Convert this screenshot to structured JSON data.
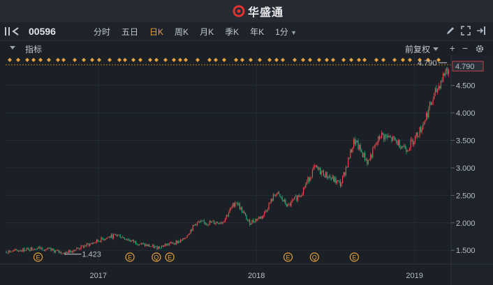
{
  "app": {
    "brand_name": "华盛通"
  },
  "toolbar": {
    "ticker": "00596",
    "tabs": [
      {
        "label": "分时",
        "active": false
      },
      {
        "label": "五日",
        "active": false
      },
      {
        "label": "日K",
        "active": true
      },
      {
        "label": "周K",
        "active": false
      },
      {
        "label": "月K",
        "active": false
      },
      {
        "label": "季K",
        "active": false
      },
      {
        "label": "年K",
        "active": false
      },
      {
        "label": "1分",
        "active": false,
        "dropdown": true
      }
    ],
    "icons": [
      "pencil-icon",
      "fullscreen-icon",
      "exit-icon"
    ]
  },
  "indicator_bar": {
    "label": "指标",
    "adjust_label": "前复权",
    "icons": [
      "plus-icon",
      "minus-icon",
      "gear-icon"
    ]
  },
  "colors": {
    "up": "#e84a4a",
    "down": "#2bb07a",
    "accent": "#e8a33c",
    "background": "#1b1f26"
  },
  "chart_data": {
    "type": "candlestick",
    "x_tick_labels": [
      "2017",
      "2018",
      "2019"
    ],
    "y_tick_labels": [
      "1.500",
      "2.000",
      "2.500",
      "3.000",
      "3.500",
      "4.000",
      "4.500"
    ],
    "ylim": [
      1.3,
      4.85
    ],
    "last_price_label": "4.790",
    "high_marker_label": "4.790",
    "low_marker_label": "1.423",
    "event_markers": [
      {
        "label": "E",
        "date": "2016-08"
      },
      {
        "label": "E",
        "date": "2017-03"
      },
      {
        "label": "Q",
        "date": "2017-05"
      },
      {
        "label": "E",
        "date": "2017-06"
      },
      {
        "label": "E",
        "date": "2018-03"
      },
      {
        "label": "Q",
        "date": "2018-05"
      },
      {
        "label": "E",
        "date": "2018-08"
      }
    ],
    "trend": [
      [
        "2016-06",
        1.48
      ],
      [
        "2016-08",
        1.55
      ],
      [
        "2016-10",
        1.45
      ],
      [
        "2016-12",
        1.62
      ],
      [
        "2017-01",
        1.72
      ],
      [
        "2017-02",
        1.78
      ],
      [
        "2017-03",
        1.68
      ],
      [
        "2017-04",
        1.6
      ],
      [
        "2017-05",
        1.55
      ],
      [
        "2017-06",
        1.62
      ],
      [
        "2017-07",
        1.68
      ],
      [
        "2017-08",
        2.0
      ],
      [
        "2017-09",
        2.0
      ],
      [
        "2017-10",
        2.02
      ],
      [
        "2017-11",
        2.4
      ],
      [
        "2017-12",
        2.0
      ],
      [
        "2018-01",
        2.12
      ],
      [
        "2018-02",
        2.55
      ],
      [
        "2018-03",
        2.3
      ],
      [
        "2018-04",
        2.55
      ],
      [
        "2018-05",
        3.0
      ],
      [
        "2018-06",
        2.85
      ],
      [
        "2018-07",
        2.7
      ],
      [
        "2018-08",
        3.5
      ],
      [
        "2018-09",
        3.1
      ],
      [
        "2018-10",
        3.6
      ],
      [
        "2018-11",
        3.5
      ],
      [
        "2018-12",
        3.35
      ],
      [
        "2019-01",
        3.7
      ],
      [
        "2019-02",
        4.3
      ],
      [
        "2019-03",
        4.79
      ]
    ]
  }
}
